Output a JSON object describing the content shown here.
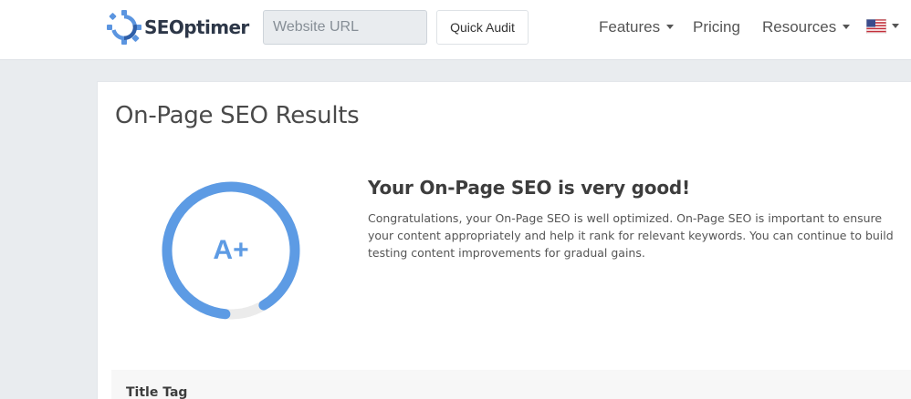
{
  "header": {
    "logo_text": "SEOptimer",
    "url_placeholder": "Website URL",
    "audit_button": "Quick Audit",
    "nav": [
      {
        "label": "Features",
        "dropdown": true
      },
      {
        "label": "Pricing",
        "dropdown": false
      },
      {
        "label": "Resources",
        "dropdown": true
      }
    ],
    "language_icon": "us-flag-icon"
  },
  "main": {
    "page_title": "On-Page SEO Results",
    "grade": "A+",
    "score_fraction": 0.9,
    "headline": "Your On-Page SEO is very good!",
    "description_lines": [
      "Congratulations, your On-Page SEO is well optimized. On-Page SEO is important to ensure",
      "your content appropriately and help it rank for relevant keywords. You can continue to build",
      "testing content improvements for gradual gains."
    ],
    "section_title": "Title Tag"
  },
  "colors": {
    "accent": "#5d9be4",
    "track": "#ebebeb",
    "page_bg": "#e9ecef"
  }
}
